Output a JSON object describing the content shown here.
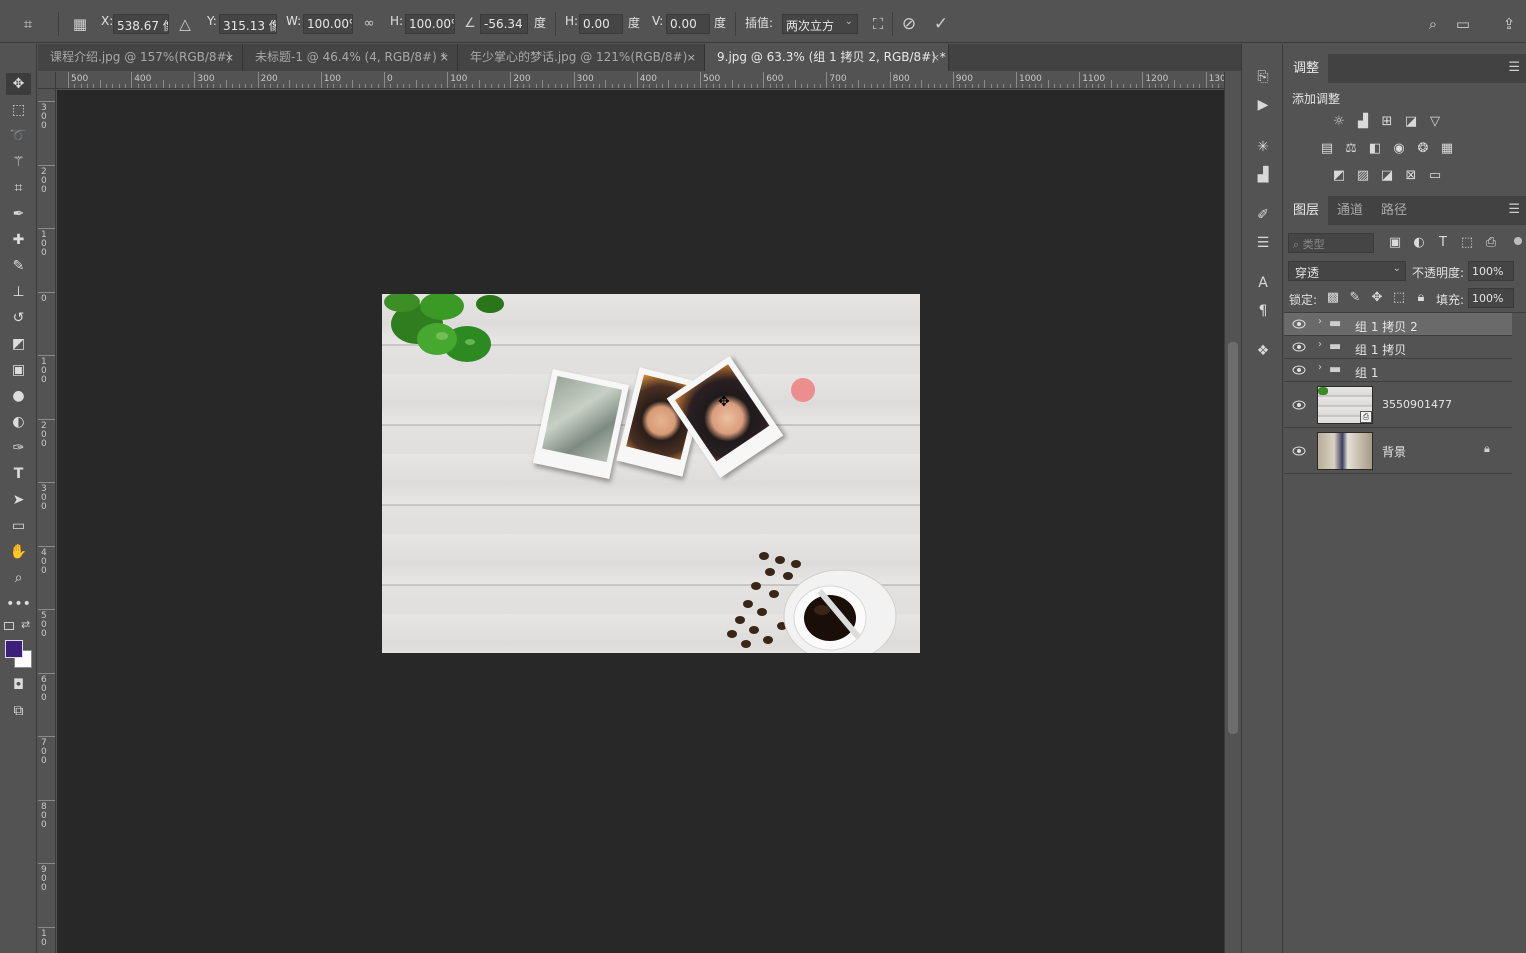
{
  "options_bar": {
    "x_label": "X:",
    "x_value": "538.67 像素",
    "y_label": "Y:",
    "y_value": "315.13 像素",
    "w_label": "W:",
    "w_value": "100.00%",
    "h_label": "H:",
    "h_value": "100.00%",
    "angle_value": "-56.34",
    "deg1": "度",
    "hskew_label": "H:",
    "hskew_value": "0.00",
    "deg2": "度",
    "vskew_label": "V:",
    "vskew_value": "0.00",
    "deg3": "度",
    "interp_label": "插值:",
    "interp_value": "两次立方"
  },
  "tabs": [
    {
      "label": "课程介绍.jpg @ 157%(RGB/8#)"
    },
    {
      "label": "未标题-1 @ 46.4% (4, RGB/8#) *"
    },
    {
      "label": "年少掌心的梦话.jpg @ 121%(RGB/8#)"
    },
    {
      "label": "9.jpg @ 63.3% (组 1 拷贝 2, RGB/8#) *"
    }
  ],
  "tab_close": "×",
  "ruler_h": [
    "500",
    "400",
    "300",
    "200",
    "100",
    "0",
    "100",
    "200",
    "300",
    "400",
    "500",
    "600",
    "700",
    "800",
    "900",
    "1000",
    "1100",
    "1200",
    "130"
  ],
  "ruler_v": [
    "3 0 0",
    "2 0 0",
    "1 0 0",
    "0",
    "1 0 0",
    "2 0 0",
    "3 0 0",
    "4 0 0",
    "5 0 0",
    "6 0 0",
    "7 0 0",
    "8 0 0",
    "9 0 0",
    "1 0"
  ],
  "adjustments": {
    "tab_label": "调整",
    "add_label": "添加调整",
    "row1": [
      "brightness-icon",
      "levels-icon",
      "curves-icon",
      "exposure-icon",
      "vibrance-icon"
    ],
    "row2": [
      "hue-icon",
      "balance-icon",
      "bw-icon",
      "photo-filter-icon",
      "channel-mixer-icon",
      "color-lookup-icon"
    ],
    "row3": [
      "invert-icon",
      "posterize-icon",
      "threshold-icon",
      "selective-color-icon",
      "gradient-map-icon"
    ]
  },
  "layers_panel": {
    "tabs": [
      "图层",
      "通道",
      "路径"
    ],
    "filter_placeholder": "类型",
    "blend_mode": "穿透",
    "opacity_label": "不透明度:",
    "opacity_value": "100%",
    "lock_label": "锁定:",
    "fill_label": "填充:",
    "fill_value": "100%",
    "layers": [
      {
        "name": "组 1 拷贝 2",
        "type": "group",
        "selected": true
      },
      {
        "name": "组 1 拷贝",
        "type": "group",
        "selected": false
      },
      {
        "name": "组 1",
        "type": "group",
        "selected": false
      },
      {
        "name": "3550901477",
        "type": "smart",
        "selected": false
      },
      {
        "name": "背景",
        "type": "background",
        "selected": false,
        "locked": true
      }
    ]
  },
  "colors": {
    "foreground": "#3c1f7a",
    "background": "#ffffff",
    "accent_dot": "#ef7f80"
  }
}
